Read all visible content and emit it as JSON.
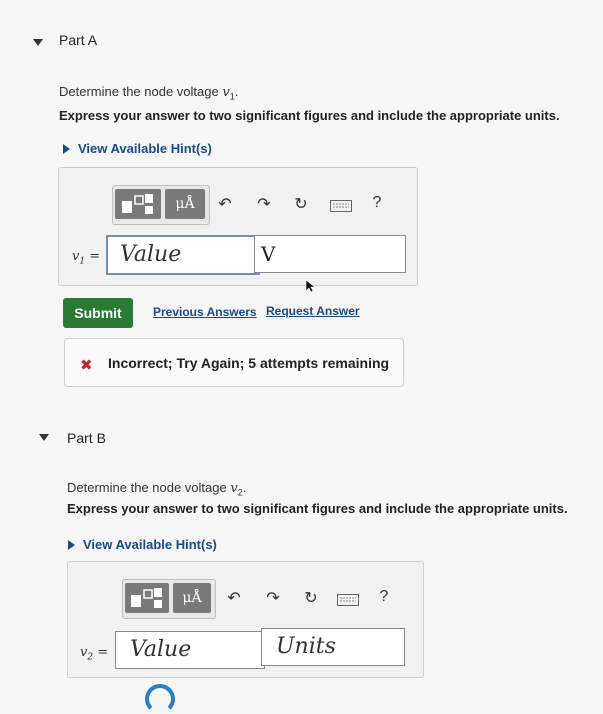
{
  "partA": {
    "title": "Part A",
    "prompt": "Determine the node voltage ",
    "var": "v",
    "sub": "1",
    "period": ".",
    "instructions": "Express your answer to two significant figures and include the appropriate units.",
    "hint": "View Available Hint(s)",
    "field_label": "v",
    "field_sub": "1",
    "eq": " =",
    "value_placeholder": "Value",
    "unit_value": "V",
    "submit": "Submit",
    "previous": "Previous Answers",
    "request": "Request Answer",
    "feedback_icon": "✖",
    "feedback": "Incorrect; Try Again; 5 attempts remaining"
  },
  "partB": {
    "title": "Part B",
    "prompt": "Determine the node voltage ",
    "var": "v",
    "sub": "2",
    "period": ".",
    "instructions": "Express your answer to two significant figures and include the appropriate units.",
    "hint": "View Available Hint(s)",
    "field_label": "v",
    "field_sub": "2",
    "eq": " =",
    "value_placeholder": "Value",
    "unit_placeholder": "Units"
  },
  "toolbar": {
    "templates_icon": "templates-icon",
    "units_label": "μÅ",
    "undo": "↶",
    "redo": "↷",
    "reset": "↻",
    "keyboard_icon": "keyboard-icon",
    "help": "?"
  },
  "colors": {
    "submit_green": "#2a7a36",
    "link_blue": "#1a4a8a",
    "error_red": "#c0262b"
  }
}
